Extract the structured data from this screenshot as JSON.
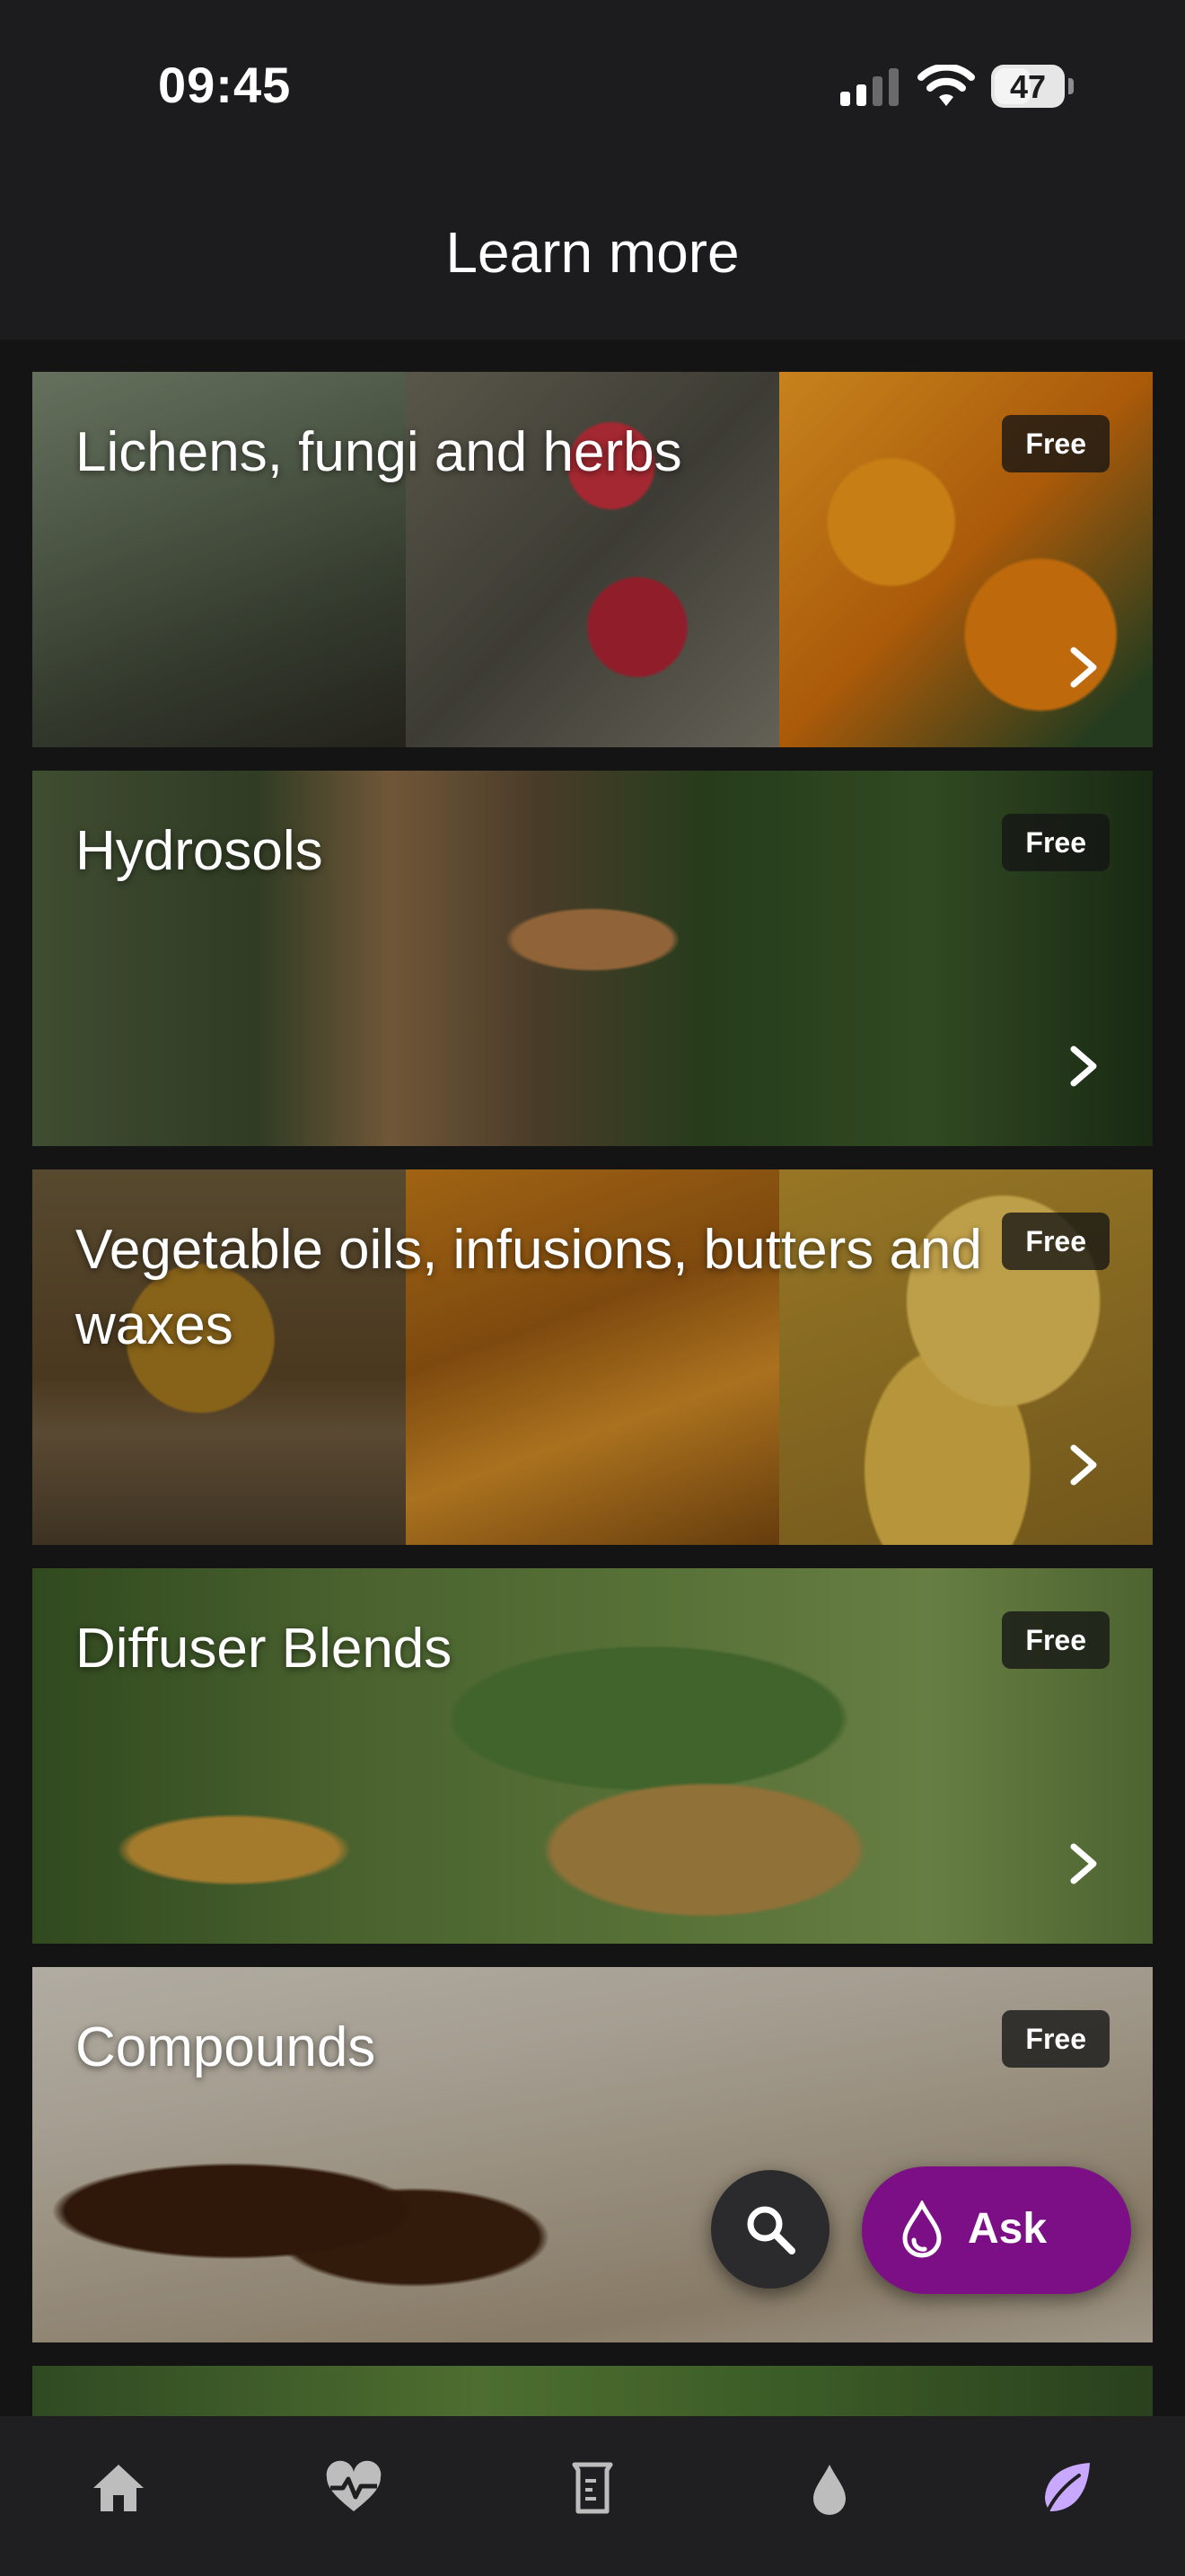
{
  "status_bar": {
    "time": "09:45",
    "battery": "47"
  },
  "header": {
    "title": "Learn more"
  },
  "cards": [
    {
      "title": "Lichens, fungi and herbs",
      "badge": "Free"
    },
    {
      "title": "Hydrosols",
      "badge": "Free"
    },
    {
      "title": "Vegetable oils, infusions, butters and waxes",
      "badge": "Free"
    },
    {
      "title": "Diffuser Blends",
      "badge": "Free"
    },
    {
      "title": "Compounds",
      "badge": "Free"
    }
  ],
  "fab": {
    "ask_label": "Ask",
    "search_icon": "search-icon",
    "ask_icon": "drop-icon"
  },
  "bottom_nav": [
    {
      "name": "home",
      "icon": "home-icon",
      "active": false
    },
    {
      "name": "health",
      "icon": "heartbeat-icon",
      "active": false
    },
    {
      "name": "lab",
      "icon": "beaker-icon",
      "active": false
    },
    {
      "name": "oils",
      "icon": "drop-icon",
      "active": false
    },
    {
      "name": "learn",
      "icon": "leaf-icon",
      "active": true
    }
  ],
  "colors": {
    "accent": "#7d0f86",
    "active_nav": "#c9a8ff",
    "inactive_nav": "#bdbdbd"
  }
}
